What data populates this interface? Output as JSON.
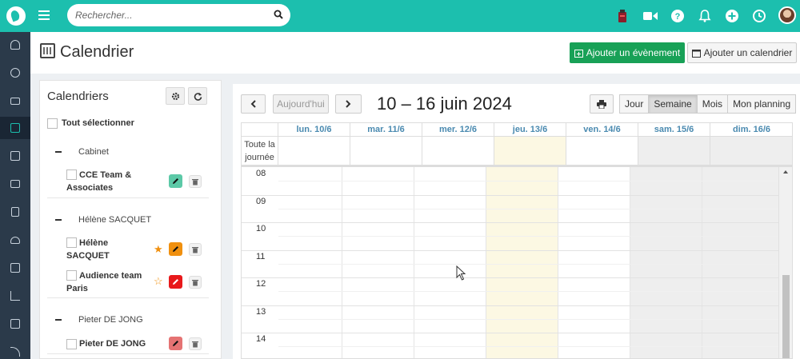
{
  "topbar": {
    "search_placeholder": "Rechercher...",
    "icons": [
      "app-logo-icon",
      "hamburger-icon",
      "search-icon",
      "extension-icon",
      "video-icon",
      "help-icon",
      "bell-icon",
      "plus-icon",
      "clock-icon",
      "avatar"
    ]
  },
  "colors": {
    "brand": "#1cbfae",
    "nav_bg": "#2b3a4a",
    "add_event": "#18a157",
    "today": "#fcf8e3",
    "weekend": "#eeeeee",
    "day_header": "#4a8ab0"
  },
  "leftnav": {
    "items": [
      "dashboard-icon",
      "contacts-icon",
      "mail-icon",
      "calendar-icon",
      "tasks-icon",
      "briefcase-icon",
      "documents-icon",
      "cloud-icon",
      "notes-icon",
      "chart-icon",
      "table-icon",
      "rss-icon"
    ],
    "active": "calendar-icon"
  },
  "header": {
    "title": "Calendrier",
    "add_event": "Ajouter un évènement",
    "add_calendar": "Ajouter un calendrier"
  },
  "calendars": {
    "title": "Calendriers",
    "select_all": "Tout sélectionner",
    "groups": [
      {
        "name": "Cabinet",
        "items": [
          {
            "label_l1": "CCE Team &",
            "label_l2": "Associates",
            "color": "#5cc9a7"
          }
        ]
      },
      {
        "name": "Hélène SACQUET",
        "items": [
          {
            "label_l1": "Hélène",
            "label_l2": "SACQUET",
            "color": "#f0900f",
            "starred": true
          },
          {
            "label_l1": "Audience team",
            "label_l2": "Paris",
            "color": "#e8191b",
            "starred": false
          }
        ]
      },
      {
        "name": "Pieter DE JONG",
        "items": [
          {
            "label_l1": "Pieter DE JONG",
            "color": "#e57373"
          }
        ]
      }
    ]
  },
  "calendar": {
    "today_button": "Aujourd'hui",
    "range": "10 – 16 juin 2024",
    "views": [
      "Jour",
      "Semaine",
      "Mois",
      "Mon planning"
    ],
    "active_view": "Semaine",
    "days": [
      "lun. 10/6",
      "mar. 11/6",
      "mer. 12/6",
      "jeu. 13/6",
      "ven. 14/6",
      "sam. 15/6",
      "dim. 16/6"
    ],
    "today_index": 3,
    "weekend_indexes": [
      5,
      6
    ],
    "allday_l1": "Toute la",
    "allday_l2": "journée",
    "hours": [
      "08",
      "09",
      "10",
      "11",
      "12",
      "13",
      "14"
    ]
  }
}
